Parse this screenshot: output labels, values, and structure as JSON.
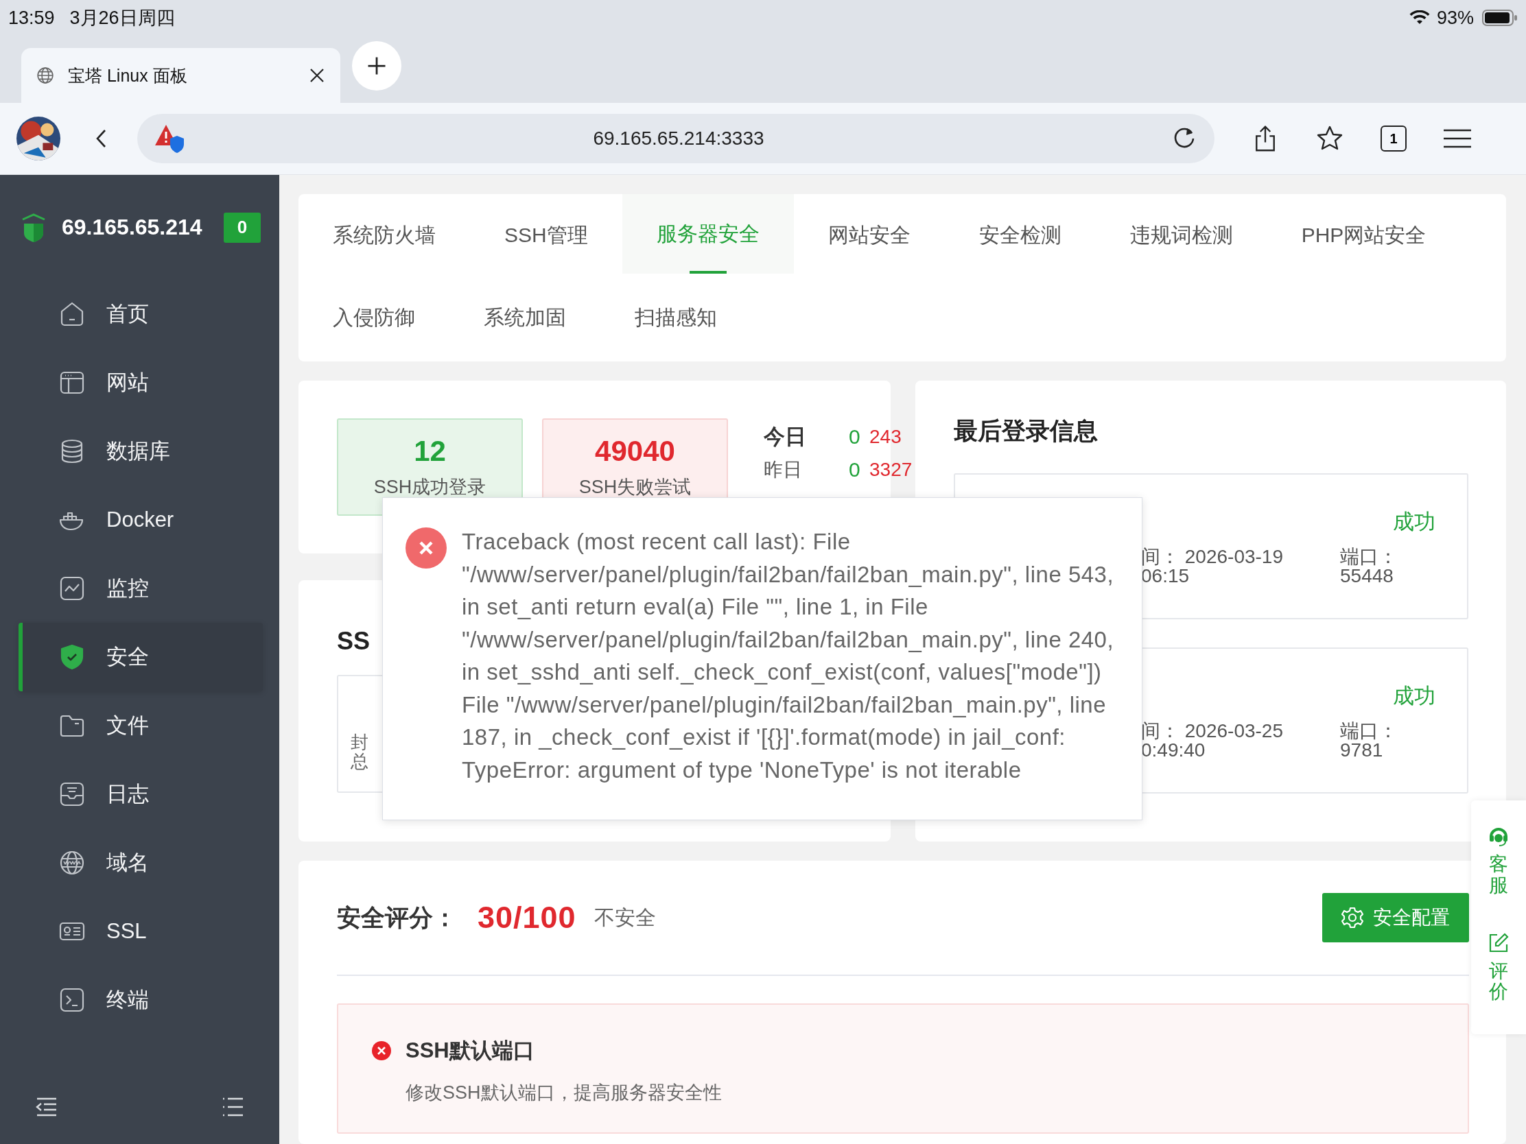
{
  "status_bar": {
    "time": "13:59",
    "date": "3月26日周四",
    "battery": "93%"
  },
  "browser": {
    "tab_title": "宝塔 Linux 面板",
    "url": "69.165.65.214:3333",
    "tab_count": "1"
  },
  "sidebar": {
    "server": "69.165.65.214",
    "badge": "0",
    "items": [
      {
        "label": "首页",
        "kind": "home",
        "selected": false
      },
      {
        "label": "网站",
        "kind": "site",
        "selected": false
      },
      {
        "label": "数据库",
        "kind": "database",
        "selected": false
      },
      {
        "label": "Docker",
        "kind": "docker",
        "selected": false
      },
      {
        "label": "监控",
        "kind": "monitor",
        "selected": false
      },
      {
        "label": "安全",
        "kind": "shield",
        "selected": true
      },
      {
        "label": "文件",
        "kind": "folder",
        "selected": false
      },
      {
        "label": "日志",
        "kind": "log",
        "selected": false
      },
      {
        "label": "域名",
        "kind": "globe",
        "selected": false
      },
      {
        "label": "SSL",
        "kind": "card",
        "selected": false
      },
      {
        "label": "终端",
        "kind": "terminal",
        "selected": false
      }
    ]
  },
  "tabs": [
    {
      "label": "系统防火墙",
      "selected": false
    },
    {
      "label": "SSH管理",
      "selected": false
    },
    {
      "label": "服务器安全",
      "selected": true
    },
    {
      "label": "网站安全",
      "selected": false
    },
    {
      "label": "安全检测",
      "selected": false
    },
    {
      "label": "违规词检测",
      "selected": false
    },
    {
      "label": "PHP网站安全",
      "selected": false
    },
    {
      "label": "入侵防御",
      "selected": false
    },
    {
      "label": "系统加固",
      "selected": false
    },
    {
      "label": "扫描感知",
      "selected": false
    }
  ],
  "stats": {
    "cards": [
      {
        "kind": "success",
        "value": "12",
        "label": "SSH成功登录"
      },
      {
        "kind": "fail",
        "value": "49040",
        "label": "SSH失败尝试"
      }
    ],
    "rows": [
      {
        "label": "今日",
        "success": "0",
        "fail": "243",
        "emphasis": true
      },
      {
        "label": "昨日",
        "success": "0",
        "fail": "3327",
        "emphasis": false
      }
    ]
  },
  "ssh_panel": {
    "title": "SS",
    "box_label_lines": [
      "封",
      "总"
    ]
  },
  "last_login": {
    "title": "最后登录信息",
    "entries": [
      {
        "status": "成功",
        "time_lines": [
          "间： 2026-03-19",
          "06:15"
        ],
        "port_label": "端口：",
        "port": "55448"
      },
      {
        "status": "成功",
        "time_lines": [
          "间： 2026-03-25",
          "0:49:40"
        ],
        "port_label": "端口：",
        "port": "9781"
      }
    ]
  },
  "score": {
    "label": "安全评分：",
    "value": "30/100",
    "verdict": "不安全",
    "button": "安全配置",
    "risks": [
      {
        "title": "SSH默认端口",
        "description": "修改SSH默认端口，提高服务器安全性"
      }
    ]
  },
  "float_bar": [
    {
      "kind": "headset",
      "label": "客服"
    },
    {
      "kind": "edit",
      "label": "评价"
    }
  ],
  "dialog": {
    "kind": "error",
    "message": "Traceback (most recent call last): File \"/www/server/panel/plugin/fail2ban/fail2ban_main.py\", line 543, in set_anti return eval(a) File \"\", line 1, in File \"/www/server/panel/plugin/fail2ban/fail2ban_main.py\", line 240, in set_sshd_anti self._check_conf_exist(conf, values[\"mode\"]) File \"/www/server/panel/plugin/fail2ban/fail2ban_main.py\", line 187, in _check_conf_exist if '[{}]'.format(mode) in jail_conf: TypeError: argument of type 'NoneType' is not iterable"
  }
}
